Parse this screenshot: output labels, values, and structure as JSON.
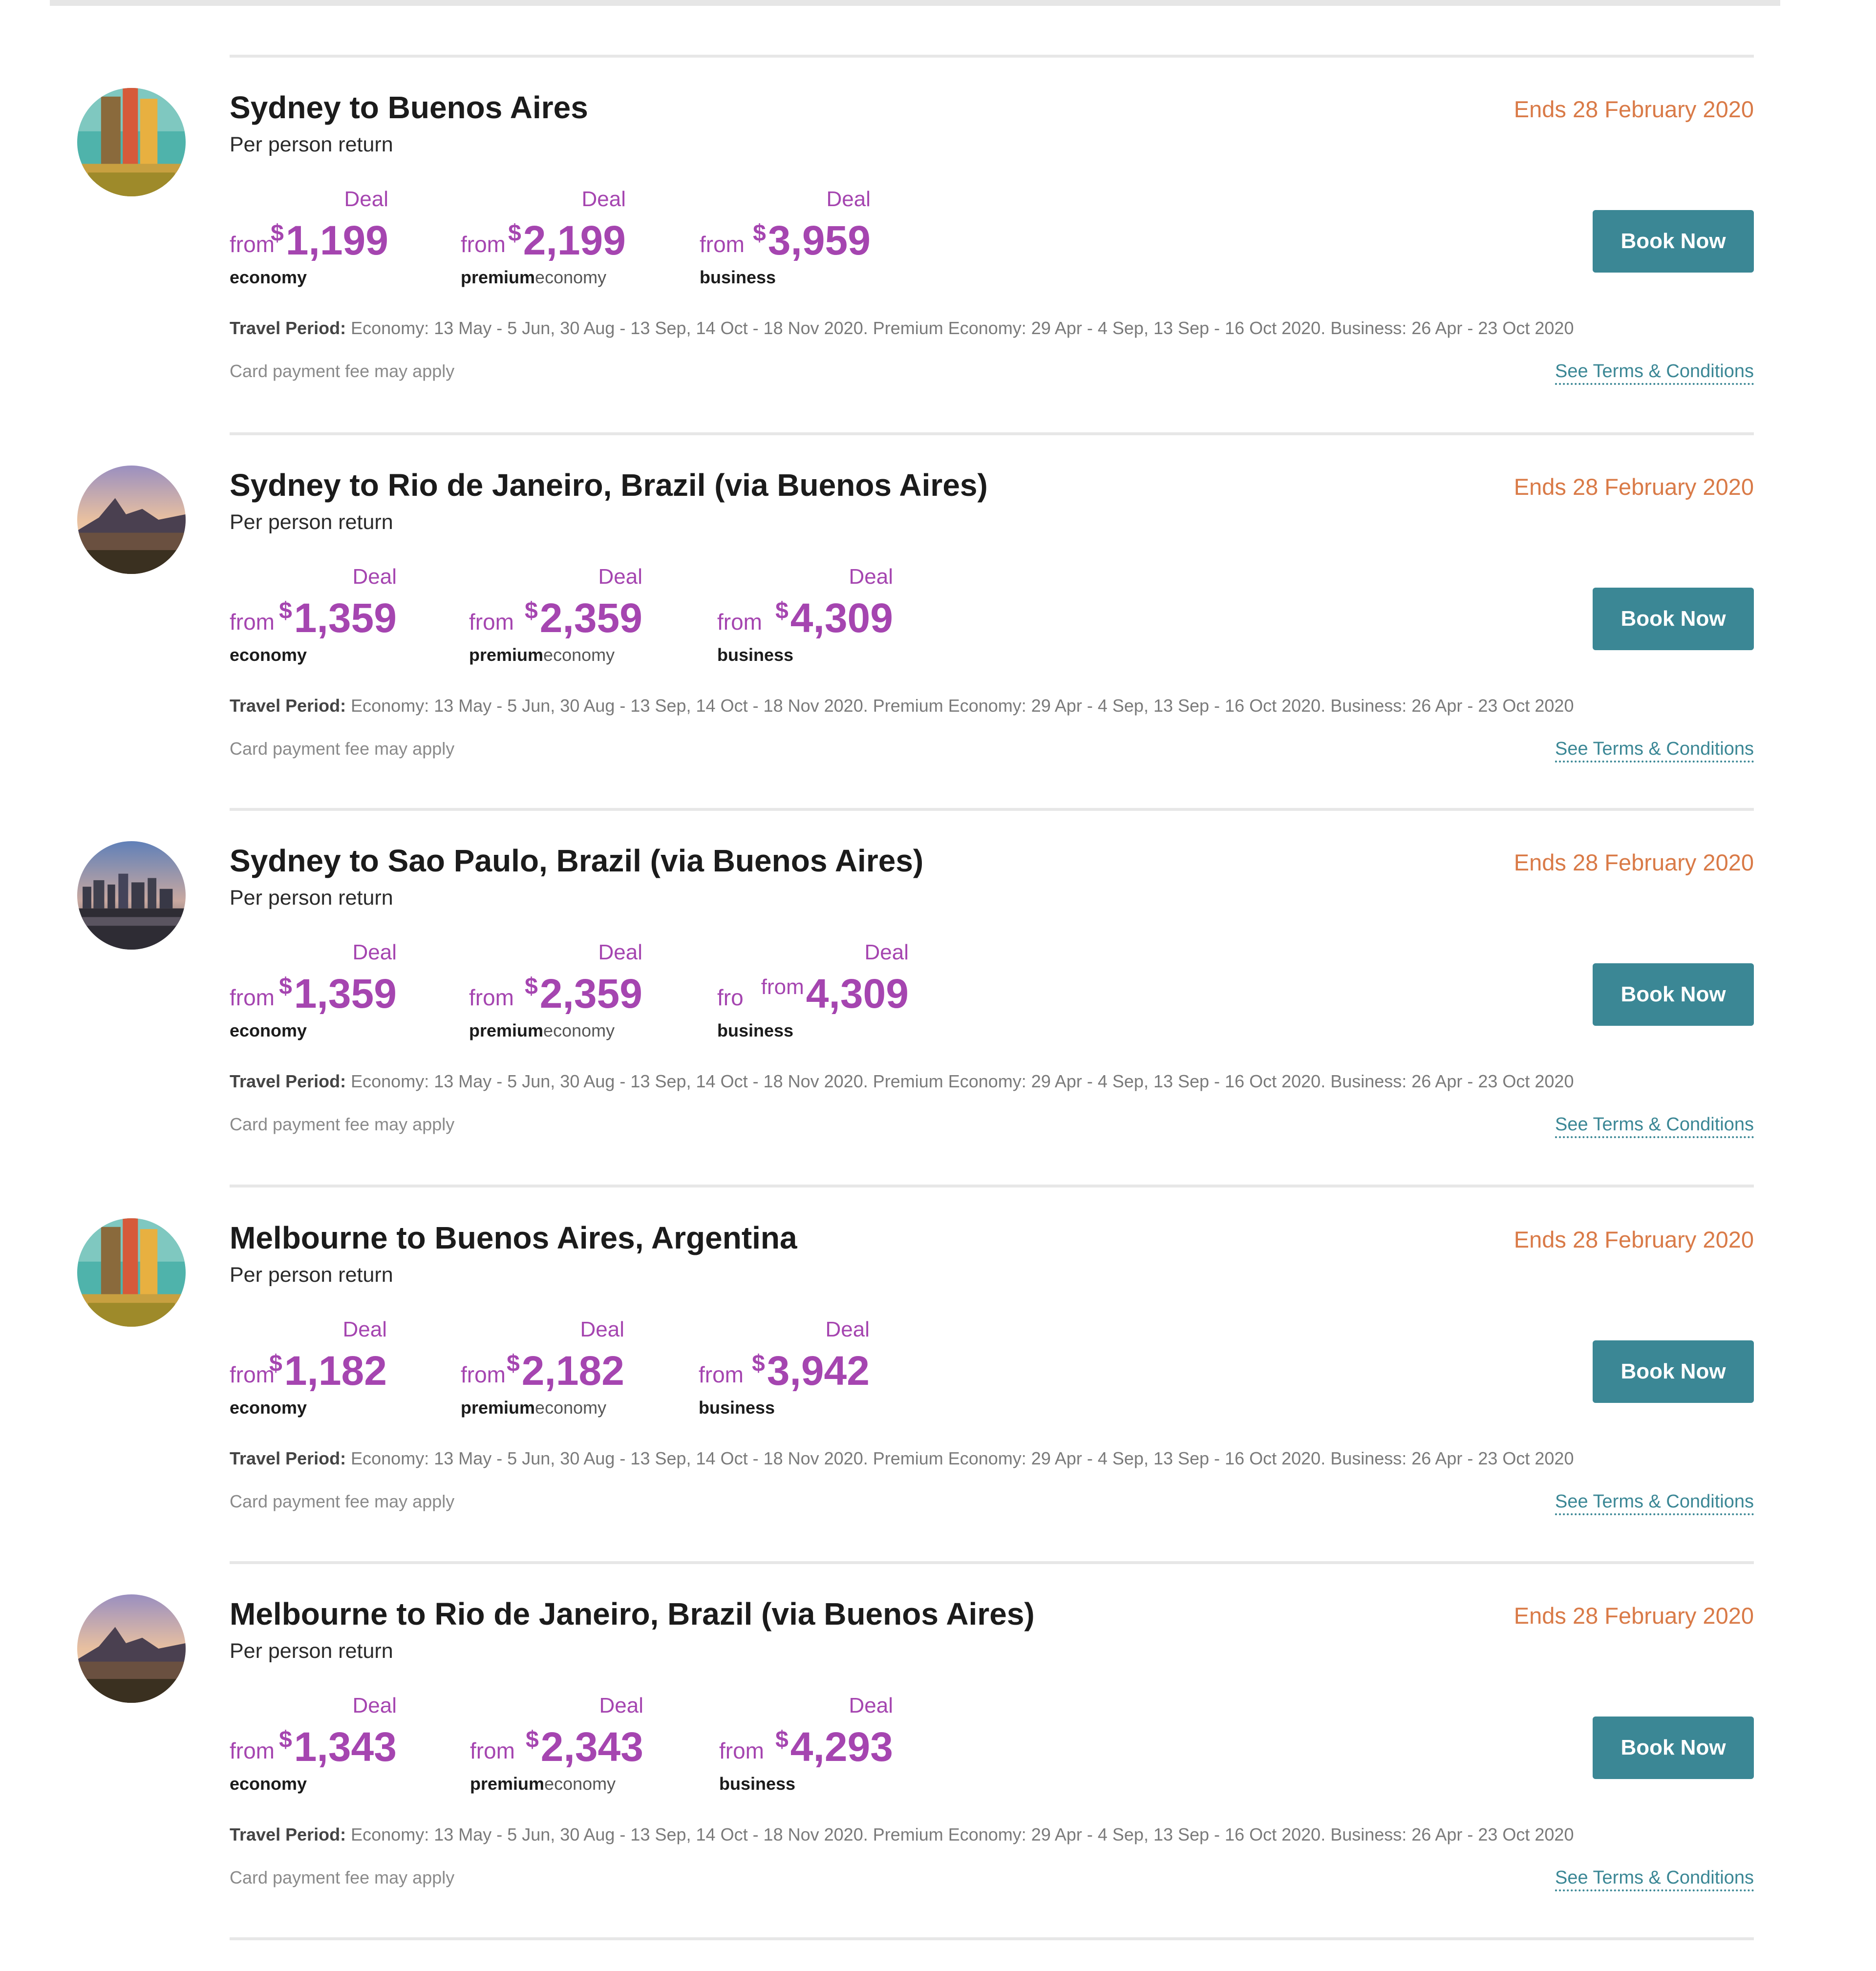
{
  "deals": [
    {
      "route": "Sydney to Buenos Aires",
      "per_person": "Per person return",
      "ends": "Ends 28 February 2020",
      "image": "buenos-aires-colorful-houses-icon",
      "fares": [
        {
          "deal": "Deal",
          "from": "from",
          "currency": "$",
          "price": "1,199",
          "cabin_bold": "economy",
          "cabin_light": ""
        },
        {
          "deal": "Deal",
          "from": "from",
          "currency": "$",
          "price": "2,199",
          "cabin_bold": "premium",
          "cabin_light": "economy"
        },
        {
          "deal": "Deal",
          "from": "from",
          "currency": "$",
          "price": "3,959",
          "cabin_bold": "business",
          "cabin_light": ""
        }
      ],
      "book_label": "Book Now",
      "travel_period_label": "Travel Period:",
      "travel_period": "Economy: 13 May - 5 Jun, 30 Aug - 13 Sep, 14 Oct - 18 Nov 2020. Premium Economy: 29 Apr - 4 Sep, 13 Sep - 16 Oct 2020. Business: 26 Apr - 23 Oct 2020",
      "fee_note": "Card payment fee may apply",
      "terms_label": "See Terms & Conditions"
    },
    {
      "route": "Sydney to Rio de Janeiro, Brazil (via Buenos Aires)",
      "per_person": "Per person return",
      "ends": "Ends 28 February 2020",
      "image": "rio-de-janeiro-sunset-icon",
      "fares": [
        {
          "deal": "Deal",
          "from": "from",
          "currency": "$",
          "price": "1,359",
          "cabin_bold": "economy",
          "cabin_light": ""
        },
        {
          "deal": "Deal",
          "from": "from",
          "currency": "$",
          "price": "2,359",
          "cabin_bold": "premium",
          "cabin_light": "economy"
        },
        {
          "deal": "Deal",
          "from": "from",
          "currency": "$",
          "price": "4,309",
          "cabin_bold": "business",
          "cabin_light": ""
        }
      ],
      "book_label": "Book Now",
      "travel_period_label": "Travel Period:",
      "travel_period": "Economy: 13 May - 5 Jun, 30 Aug - 13 Sep, 14 Oct - 18 Nov 2020. Premium Economy: 29 Apr - 4 Sep, 13 Sep - 16 Oct 2020. Business: 26 Apr - 23 Oct 2020",
      "fee_note": "Card payment fee may apply",
      "terms_label": "See Terms & Conditions"
    },
    {
      "route": "Sydney to Sao Paulo, Brazil (via Buenos Aires)",
      "per_person": "Per person return",
      "ends": "Ends 28 February 2020",
      "image": "sao-paulo-skyline-icon",
      "fares": [
        {
          "deal": "Deal",
          "from": "from",
          "currency": "$",
          "price": "1,359",
          "cabin_bold": "economy",
          "cabin_light": ""
        },
        {
          "deal": "Deal",
          "from": "from",
          "currency": "$",
          "price": "2,359",
          "cabin_bold": "premium",
          "cabin_light": "economy"
        },
        {
          "deal": "Deal",
          "from": "fro",
          "currency": "from",
          "price": "4,309",
          "cabin_bold": "business",
          "cabin_light": ""
        }
      ],
      "book_label": "Book Now",
      "travel_period_label": "Travel Period:",
      "travel_period": "Economy: 13 May - 5 Jun, 30 Aug - 13 Sep, 14 Oct - 18 Nov 2020. Premium Economy: 29 Apr - 4 Sep, 13 Sep - 16 Oct 2020. Business: 26 Apr - 23 Oct 2020",
      "fee_note": "Card payment fee may apply",
      "terms_label": "See Terms & Conditions"
    },
    {
      "route": "Melbourne to Buenos Aires, Argentina",
      "per_person": "Per person return",
      "ends": "Ends 28 February 2020",
      "image": "buenos-aires-colorful-houses-icon",
      "fares": [
        {
          "deal": "Deal",
          "from": "from",
          "currency": "$",
          "price": "1,182",
          "cabin_bold": "economy",
          "cabin_light": ""
        },
        {
          "deal": "Deal",
          "from": "from",
          "currency": "$",
          "price": "2,182",
          "cabin_bold": "premium",
          "cabin_light": "economy"
        },
        {
          "deal": "Deal",
          "from": "from",
          "currency": "$",
          "price": "3,942",
          "cabin_bold": "business",
          "cabin_light": ""
        }
      ],
      "book_label": "Book Now",
      "travel_period_label": "Travel Period:",
      "travel_period": "Economy: 13 May - 5 Jun, 30 Aug - 13 Sep, 14 Oct - 18 Nov 2020. Premium Economy: 29 Apr - 4 Sep, 13 Sep - 16 Oct 2020. Business: 26 Apr - 23 Oct 2020",
      "fee_note": "Card payment fee may apply",
      "terms_label": "See Terms & Conditions"
    },
    {
      "route": "Melbourne to Rio de Janeiro, Brazil (via Buenos Aires)",
      "per_person": "Per person return",
      "ends": "Ends 28 February 2020",
      "image": "rio-de-janeiro-sunset-icon",
      "fares": [
        {
          "deal": "Deal",
          "from": "from",
          "currency": "$",
          "price": "1,343",
          "cabin_bold": "economy",
          "cabin_light": ""
        },
        {
          "deal": "Deal",
          "from": "from",
          "currency": "$",
          "price": "2,343",
          "cabin_bold": "premium",
          "cabin_light": "economy"
        },
        {
          "deal": "Deal",
          "from": "from",
          "currency": "$",
          "price": "4,293",
          "cabin_bold": "business",
          "cabin_light": ""
        }
      ],
      "book_label": "Book Now",
      "travel_period_label": "Travel Period:",
      "travel_period": "Economy: 13 May - 5 Jun, 30 Aug - 13 Sep, 14 Oct - 18 Nov 2020. Premium Economy: 29 Apr - 4 Sep, 13 Sep - 16 Oct 2020. Business: 26 Apr - 23 Oct 2020",
      "fee_note": "Card payment fee may apply",
      "terms_label": "See Terms & Conditions"
    }
  ],
  "colors": {
    "deal_purple": "#a545b0",
    "ends_orange": "#d97a47",
    "button_teal": "#3b8795",
    "divider_gray": "#e7e7e7"
  }
}
